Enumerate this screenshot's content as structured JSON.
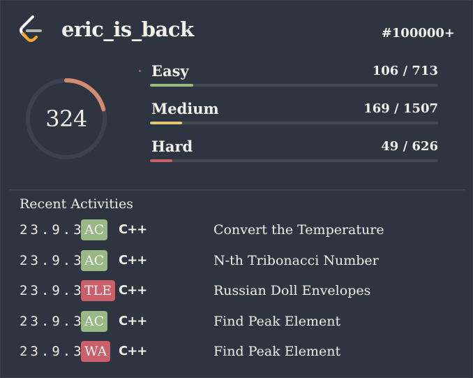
{
  "header": {
    "username": "eric_is_back",
    "rank": "#100000+",
    "logo_icon": "leetcode-logo-icon"
  },
  "progress": {
    "total_solved": "324",
    "ring_fraction": 0.21,
    "colors": {
      "ring_track": "#3b414d",
      "ring_fill": "#d48b72"
    }
  },
  "difficulties": [
    {
      "label": "Easy",
      "count": "106 / 713",
      "fraction": 0.149,
      "color": "#98b984"
    },
    {
      "label": "Medium",
      "count": "169 / 1507",
      "fraction": 0.112,
      "color": "#e3c57a"
    },
    {
      "label": "Hard",
      "count": "49 / 626",
      "fraction": 0.078,
      "color": "#c9606a"
    }
  ],
  "recent": {
    "title": "Recent Activities",
    "items": [
      {
        "date": "23.9.3",
        "status": "AC",
        "status_color": "#98b984",
        "lang": "C++",
        "problem": "Convert the Temperature"
      },
      {
        "date": "23.9.3",
        "status": "AC",
        "status_color": "#98b984",
        "lang": "C++",
        "problem": "N-th Tribonacci Number"
      },
      {
        "date": "23.9.3",
        "status": "TLE",
        "status_color": "#c9606a",
        "lang": "C++",
        "problem": "Russian Doll Envelopes"
      },
      {
        "date": "23.9.3",
        "status": "AC",
        "status_color": "#98b984",
        "lang": "C++",
        "problem": "Find Peak Element"
      },
      {
        "date": "23.9.3",
        "status": "WA",
        "status_color": "#c9606a",
        "lang": "C++",
        "problem": "Find Peak Element"
      }
    ]
  }
}
